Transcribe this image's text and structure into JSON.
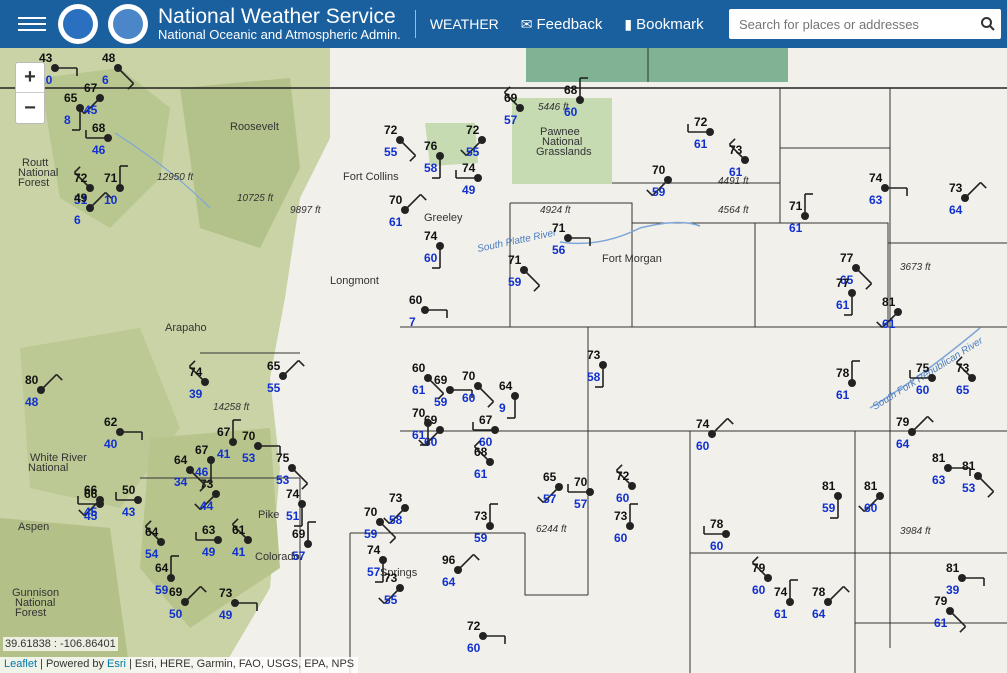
{
  "header": {
    "title": "National Weather Service",
    "subtitle": "National Oceanic and Atmospheric Admin.",
    "nav_weather": "WEATHER",
    "nav_feedback": "Feedback",
    "nav_bookmark": "Bookmark",
    "search_placeholder": "Search for places or addresses"
  },
  "map": {
    "coords": "39.61838 : -106.86401",
    "attribution": {
      "leaflet": "Leaflet",
      "powered": "| Powered by",
      "esri": "Esri",
      "sources": "| Esri, HERE, Garmin, FAO, USGS, EPA, NPS"
    },
    "places": [
      {
        "name": "Fort Collins"
      },
      {
        "name": "Greeley"
      },
      {
        "name": "Fort Morgan"
      },
      {
        "name": "Longmont"
      },
      {
        "name": "Pawnee"
      },
      {
        "name": "National"
      },
      {
        "name": "Grasslands"
      },
      {
        "name": "Routt"
      },
      {
        "name": "National"
      },
      {
        "name": "Forest"
      },
      {
        "name": "Arapaho"
      },
      {
        "name": "White River"
      },
      {
        "name": "National"
      },
      {
        "name": "Aspen"
      },
      {
        "name": "Gunnison"
      },
      {
        "name": "National"
      },
      {
        "name": "Forest"
      },
      {
        "name": "Pike"
      },
      {
        "name": "Roosevelt"
      },
      {
        "name": "Colorado"
      },
      {
        "name": "Springs"
      }
    ],
    "elevations": [
      "5446 ft",
      "4924 ft",
      "4491 ft",
      "4564 ft",
      "3673 ft",
      "12950 ft",
      "10725 ft",
      "9897 ft",
      "14258 ft",
      "6244 ft",
      "3984 ft"
    ],
    "rivers": [
      "South Platte River",
      "South Fork Republican River"
    ],
    "stations": [
      {
        "t": "43",
        "d": "10"
      },
      {
        "t": "48",
        "d": "6"
      },
      {
        "t": "65",
        "d": "8"
      },
      {
        "t": "67",
        "d": "45"
      },
      {
        "t": "68",
        "d": "46"
      },
      {
        "t": "72",
        "d": "51"
      },
      {
        "t": "71",
        "d": "10"
      },
      {
        "t": "49",
        "d": "6"
      },
      {
        "t": "60",
        "d": "7"
      },
      {
        "t": "72",
        "d": "55"
      },
      {
        "t": "76",
        "d": "58"
      },
      {
        "t": "72",
        "d": "55"
      },
      {
        "t": "74",
        "d": "49"
      },
      {
        "t": "69",
        "d": "57"
      },
      {
        "t": "68",
        "d": "60"
      },
      {
        "t": "70",
        "d": "61"
      },
      {
        "t": "71",
        "d": "56"
      },
      {
        "t": "71",
        "d": "59"
      },
      {
        "t": "74",
        "d": "60"
      },
      {
        "t": "70",
        "d": "59"
      },
      {
        "t": "72",
        "d": "61"
      },
      {
        "t": "73",
        "d": "61"
      },
      {
        "t": "71",
        "d": "61"
      },
      {
        "t": "73",
        "d": "64"
      },
      {
        "t": "74",
        "d": "63"
      },
      {
        "t": "77",
        "d": "65"
      },
      {
        "t": "77",
        "d": "61"
      },
      {
        "t": "81",
        "d": "61"
      },
      {
        "t": "75",
        "d": "60"
      },
      {
        "t": "73",
        "d": "65"
      },
      {
        "t": "78",
        "d": "61"
      },
      {
        "t": "79",
        "d": "64"
      },
      {
        "t": "81",
        "d": "63"
      },
      {
        "t": "81",
        "d": "53"
      },
      {
        "t": "81",
        "d": "59"
      },
      {
        "t": "81",
        "d": "60"
      },
      {
        "t": "78",
        "d": "60"
      },
      {
        "t": "79",
        "d": "60"
      },
      {
        "t": "74",
        "d": "61"
      },
      {
        "t": "78",
        "d": "64"
      },
      {
        "t": "81",
        "d": "39"
      },
      {
        "t": "79",
        "d": "61"
      },
      {
        "t": "73",
        "d": "58"
      },
      {
        "t": "65",
        "d": "57"
      },
      {
        "t": "70",
        "d": "57"
      },
      {
        "t": "72",
        "d": "60"
      },
      {
        "t": "73",
        "d": "60"
      },
      {
        "t": "74",
        "d": "60"
      },
      {
        "t": "69",
        "d": "59"
      },
      {
        "t": "70",
        "d": "60"
      },
      {
        "t": "64",
        "d": "9"
      },
      {
        "t": "69",
        "d": "60"
      },
      {
        "t": "67",
        "d": "60"
      },
      {
        "t": "68",
        "d": "61"
      },
      {
        "t": "73",
        "d": "59"
      },
      {
        "t": "96",
        "d": "64"
      },
      {
        "t": "72",
        "d": "60"
      },
      {
        "t": "60",
        "d": "61"
      },
      {
        "t": "70",
        "d": "61"
      },
      {
        "t": "73",
        "d": "58"
      },
      {
        "t": "66",
        "d": "45"
      },
      {
        "t": "74",
        "d": "39"
      },
      {
        "t": "67",
        "d": "41"
      },
      {
        "t": "65",
        "d": "55"
      },
      {
        "t": "70",
        "d": "53"
      },
      {
        "t": "75",
        "d": "53"
      },
      {
        "t": "74",
        "d": "51"
      },
      {
        "t": "73",
        "d": "44"
      },
      {
        "t": "63",
        "d": "49"
      },
      {
        "t": "61",
        "d": "41"
      },
      {
        "t": "69",
        "d": "57"
      },
      {
        "t": "80",
        "d": "48"
      },
      {
        "t": "62",
        "d": "40"
      },
      {
        "t": "64",
        "d": "34"
      },
      {
        "t": "67",
        "d": "46"
      },
      {
        "t": "66",
        "d": "45"
      },
      {
        "t": "50",
        "d": "43"
      },
      {
        "t": "64",
        "d": "54"
      },
      {
        "t": "64",
        "d": "59"
      },
      {
        "t": "69",
        "d": "50"
      },
      {
        "t": "73",
        "d": "49"
      },
      {
        "t": "70",
        "d": "59"
      },
      {
        "t": "74",
        "d": "57"
      },
      {
        "t": "73",
        "d": "55"
      }
    ]
  }
}
